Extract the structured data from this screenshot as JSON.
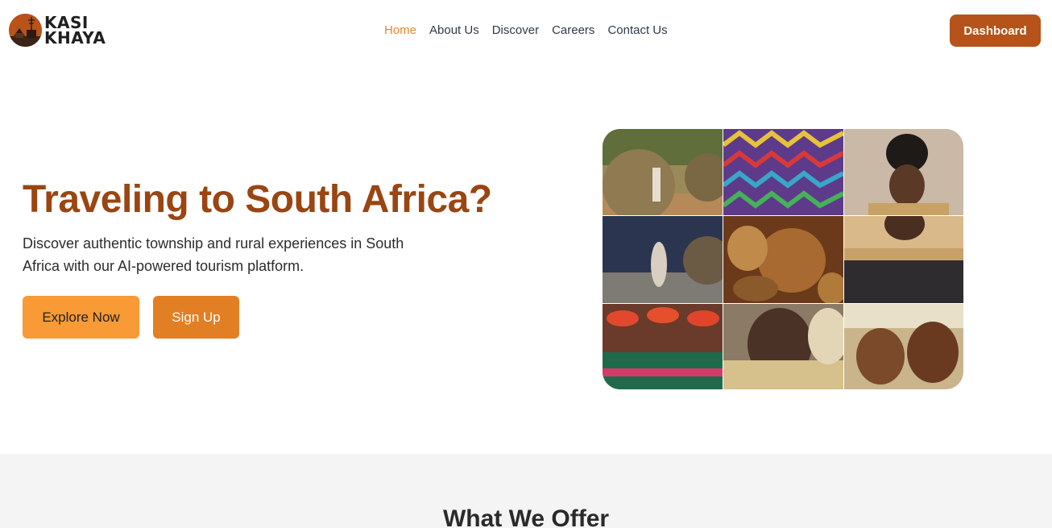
{
  "brand": {
    "line1": "KASI",
    "line2": "KHAYA",
    "accent": "#b5531a"
  },
  "nav": {
    "items": [
      {
        "label": "Home",
        "active": true
      },
      {
        "label": "About Us",
        "active": false
      },
      {
        "label": "Discover",
        "active": false
      },
      {
        "label": "Careers",
        "active": false
      },
      {
        "label": "Contact Us",
        "active": false
      }
    ],
    "active_color": "#e5892b"
  },
  "header": {
    "dashboard_label": "Dashboard"
  },
  "hero": {
    "title": "Traveling to South Africa?",
    "subtitle": "Discover authentic township and rural experiences in South Africa with our AI-powered tourism platform.",
    "explore_label": "Explore Now",
    "signup_label": "Sign Up",
    "title_color": "#9a4512"
  },
  "collage": {
    "tiles": [
      "beehive-hut-photo",
      "beadwork-pattern-photo",
      "zulu-chief-photo",
      "traditional-dancer-photo",
      "woven-baskets-photo",
      "leopard-shield-photo",
      "zulu-women-photo",
      "elder-leopard-skin-photo",
      "warriors-procession-photo"
    ]
  },
  "offer": {
    "title": "What We Offer"
  }
}
